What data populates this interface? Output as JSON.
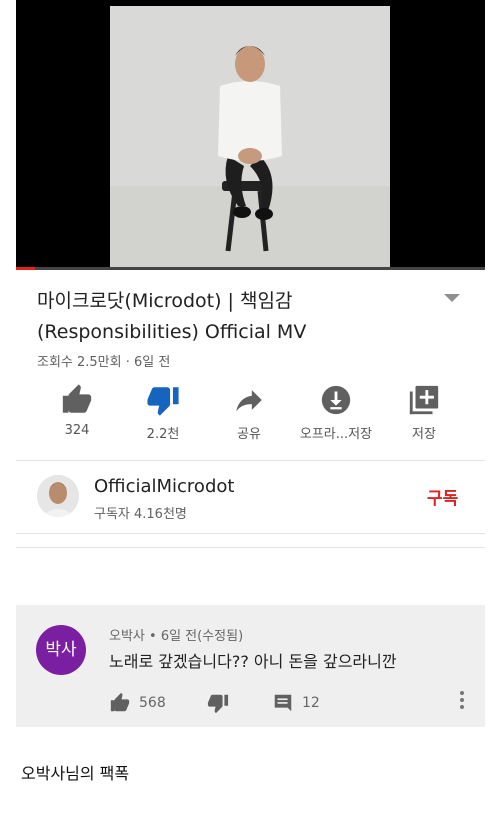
{
  "video": {
    "progress": 0.04
  },
  "title": {
    "line1": "마이크로닷(Microdot) | 책임감",
    "line2": "(Responsibilities) Official MV"
  },
  "meta": "조회수 2.5만회 · 6일 전",
  "actions": {
    "like": "324",
    "dislike": "2.2천",
    "share": "공유",
    "offline": "오프라...저장",
    "save": "저장"
  },
  "channel": {
    "name": "OfficialMicrodot",
    "subscribers": "구독자 4.16천명",
    "subscribe_label": "구독"
  },
  "comment": {
    "avatar_text": "박사",
    "header": "오박사 • 6일 전(수정됨)",
    "text": "노래로 갚겠습니다?? 아니 돈을 갚으라니깐",
    "likes": "568",
    "replies": "12"
  },
  "caption": "오박사님의 팩폭",
  "colors": {
    "subscribe": "#dd2222",
    "dislike_active": "#1565c0",
    "avatar_bg": "#7b1fa2",
    "progress": "#e62117"
  }
}
